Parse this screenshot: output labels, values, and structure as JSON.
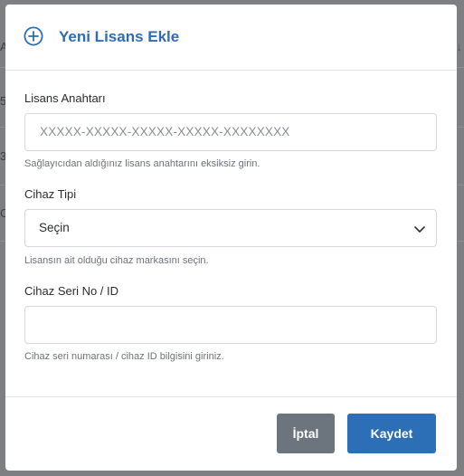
{
  "background": {
    "row_chars": [
      "A",
      "5",
      "3",
      "C"
    ]
  },
  "modal": {
    "title": "Yeni Lisans Ekle",
    "title_icon": "plus-circle-icon",
    "accent_color": "#2f6db2",
    "fields": {
      "license_key": {
        "label": "Lisans Anahtarı",
        "placeholder": "XXXXX-XXXXX-XXXXX-XXXXX-XXXXXXXX",
        "help": "Sağlayıcıdan aldığınız lisans anahtarını eksiksiz girin."
      },
      "device_type": {
        "label": "Cihaz Tipi",
        "selected": "Seçin",
        "help": "Lisansın ait olduğu cihaz markasını seçin."
      },
      "device_serial": {
        "label": "Cihaz Seri No / ID",
        "value": "",
        "help": "Cihaz seri numarası / cihaz ID bilgisini giriniz."
      }
    },
    "buttons": {
      "cancel": "İptal",
      "save": "Kaydet"
    }
  }
}
